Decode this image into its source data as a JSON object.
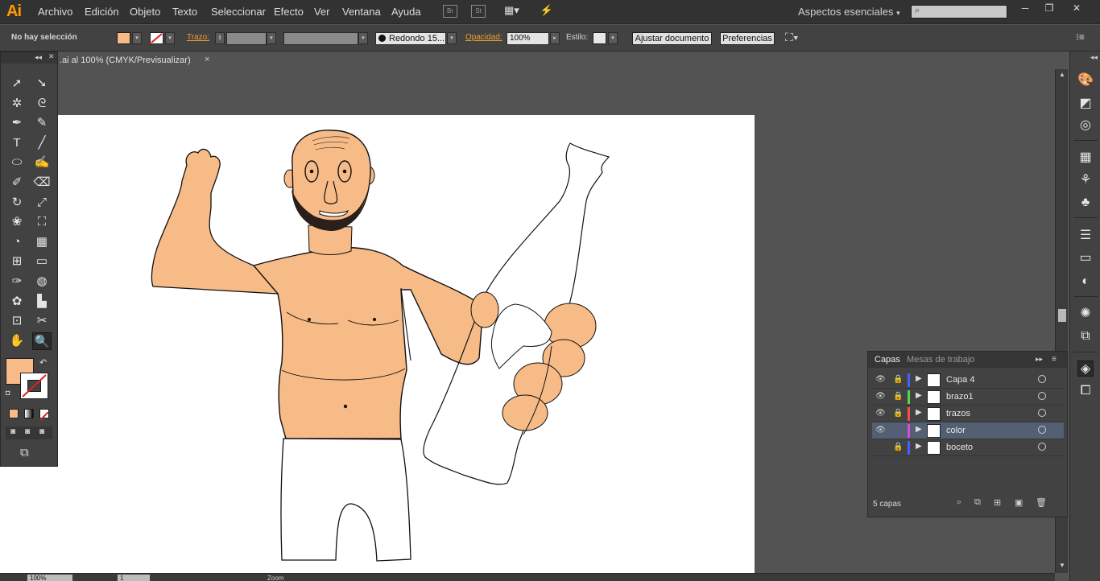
{
  "app": {
    "logo": "Ai",
    "menu": [
      "Archivo",
      "Edición",
      "Objeto",
      "Texto",
      "Seleccionar",
      "Efecto",
      "Ver",
      "Ventana",
      "Ayuda"
    ],
    "bridge_label": "Br",
    "stock_label": "St",
    "workspace": "Aspectos esenciales",
    "search_placeholder": ""
  },
  "control_bar": {
    "selection_status": "No hay selección",
    "fill_color": "#f7bb87",
    "stroke_label": "Trazo:",
    "brush_label": "Redondo 15...",
    "opacity_label": "Opacidad:",
    "opacity_value": "100%",
    "style_label": "Estilo:",
    "fit_document_button": "Ajustar documento",
    "preferences_button": "Preferencias"
  },
  "document": {
    "tab_title": ".ai al 100% (CMYK/Previsualizar)",
    "tab_close": "×"
  },
  "tools": {
    "fill_color": "#f7bb87",
    "items": [
      {
        "name": "selection-tool",
        "glyph": "➚"
      },
      {
        "name": "direct-selection-tool",
        "glyph": "➘"
      },
      {
        "name": "magic-wand-tool",
        "glyph": "✲"
      },
      {
        "name": "lasso-tool",
        "glyph": "ᘓ"
      },
      {
        "name": "pen-tool",
        "glyph": "✒"
      },
      {
        "name": "curvature-tool",
        "glyph": "✎"
      },
      {
        "name": "type-tool",
        "glyph": "T"
      },
      {
        "name": "line-tool",
        "glyph": "╱"
      },
      {
        "name": "ellipse-tool",
        "glyph": "⬭"
      },
      {
        "name": "paintbrush-tool",
        "glyph": "✍"
      },
      {
        "name": "shaper-tool",
        "glyph": "✐"
      },
      {
        "name": "eraser-tool",
        "glyph": "⌫"
      },
      {
        "name": "rotate-tool",
        "glyph": "↻"
      },
      {
        "name": "scale-tool",
        "glyph": "⤢"
      },
      {
        "name": "warp-tool",
        "glyph": "❀"
      },
      {
        "name": "free-transform-tool",
        "glyph": "⛶"
      },
      {
        "name": "shape-builder-tool",
        "glyph": "◔"
      },
      {
        "name": "perspective-grid-tool",
        "glyph": "▦"
      },
      {
        "name": "mesh-tool",
        "glyph": "⊞"
      },
      {
        "name": "gradient-tool",
        "glyph": "▭"
      },
      {
        "name": "eyedropper-tool",
        "glyph": "✑"
      },
      {
        "name": "blend-tool",
        "glyph": "◍"
      },
      {
        "name": "symbol-sprayer-tool",
        "glyph": "✿"
      },
      {
        "name": "column-graph-tool",
        "glyph": "▙"
      },
      {
        "name": "artboard-tool",
        "glyph": "⊡"
      },
      {
        "name": "slice-tool",
        "glyph": "✂"
      },
      {
        "name": "hand-tool",
        "glyph": "✋"
      },
      {
        "name": "zoom-tool",
        "glyph": "🔍"
      }
    ]
  },
  "layers_panel": {
    "tab_layers": "Capas",
    "tab_artboards": "Mesas de trabajo",
    "count_label": "5 capas",
    "layers": [
      {
        "name": "Capa 4",
        "color": "#4a5cff",
        "visible": true,
        "locked": true,
        "selected": false
      },
      {
        "name": "brazo1",
        "color": "#4cd94c",
        "visible": true,
        "locked": true,
        "selected": false
      },
      {
        "name": "trazos",
        "color": "#ff4a4a",
        "visible": true,
        "locked": true,
        "selected": false
      },
      {
        "name": "color",
        "color": "#d94cd9",
        "visible": true,
        "locked": false,
        "selected": true
      },
      {
        "name": "boceto",
        "color": "#4a5cff",
        "visible": false,
        "locked": true,
        "selected": false
      }
    ]
  },
  "status_bar": {
    "zoom": "100%",
    "artboard_number": "1",
    "tool_name": "Zoom"
  }
}
